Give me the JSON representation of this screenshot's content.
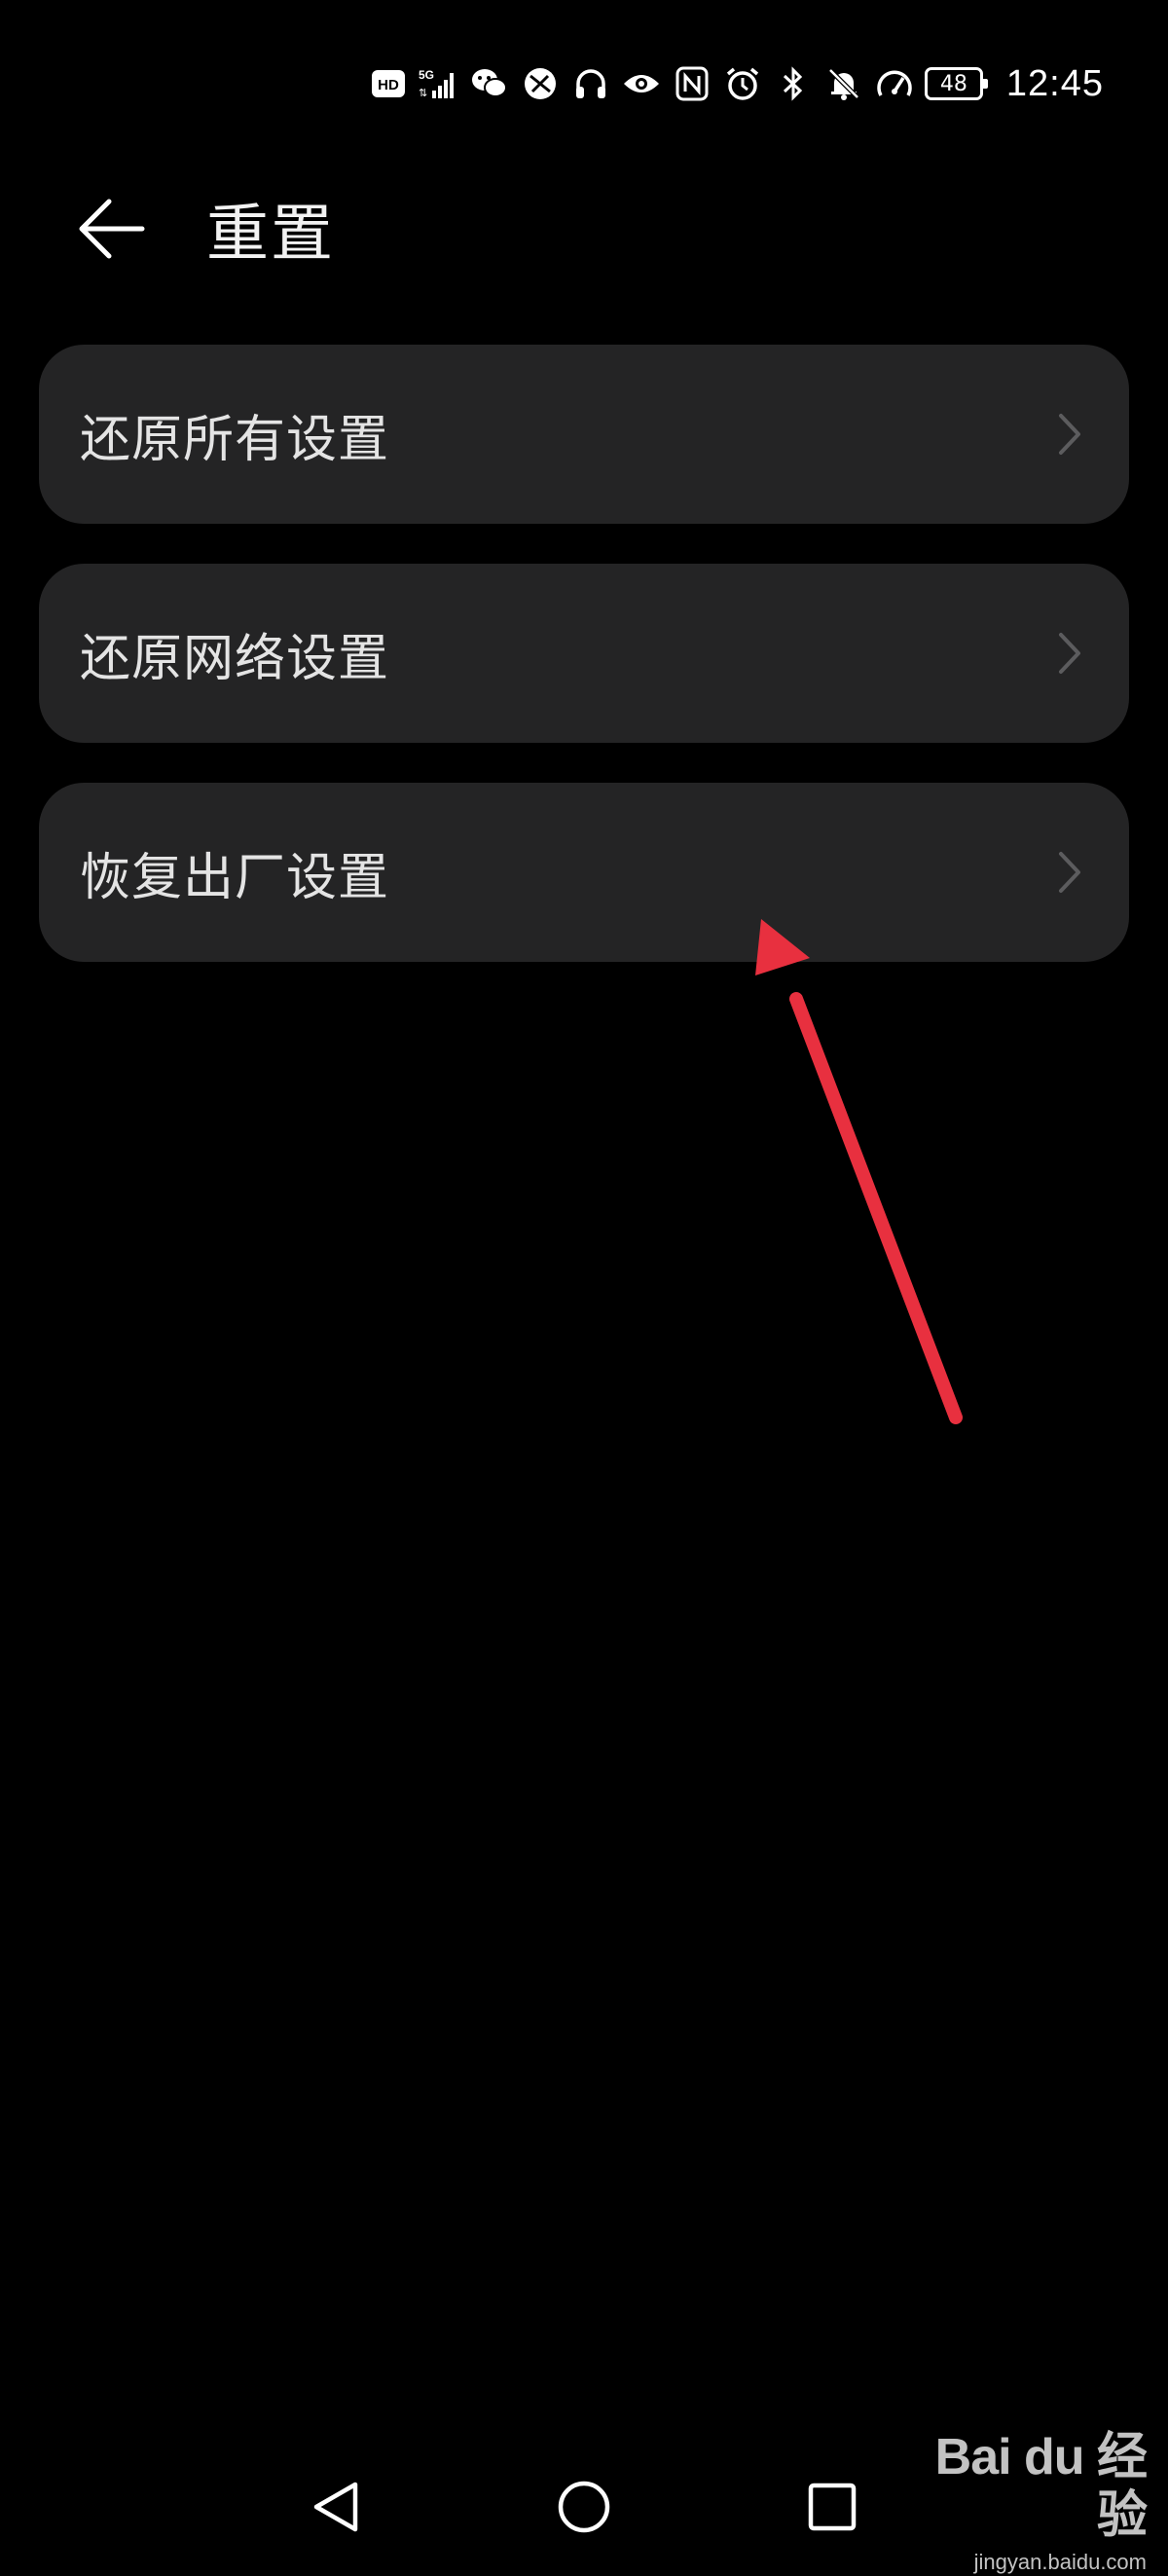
{
  "status_bar": {
    "icons": [
      "hd-icon",
      "signal-5g-icon",
      "wechat-icon",
      "app-icon",
      "headphones-icon",
      "eye-comfort-icon",
      "nfc-icon",
      "alarm-icon",
      "bluetooth-icon",
      "mute-bell-icon",
      "speed-icon"
    ],
    "battery": "48",
    "time": "12:45"
  },
  "header": {
    "title": "重置"
  },
  "menu": {
    "items": [
      {
        "label": "还原所有设置"
      },
      {
        "label": "还原网络设置"
      },
      {
        "label": "恢复出厂设置"
      }
    ]
  },
  "watermark": {
    "logo": "Bai du 经验",
    "url": "jingyan.baidu.com"
  },
  "colors": {
    "background": "#000000",
    "card": "#242425",
    "text": "#e4e4e4",
    "chevron": "#5c5c5e",
    "annotation_arrow": "#e8303f"
  }
}
